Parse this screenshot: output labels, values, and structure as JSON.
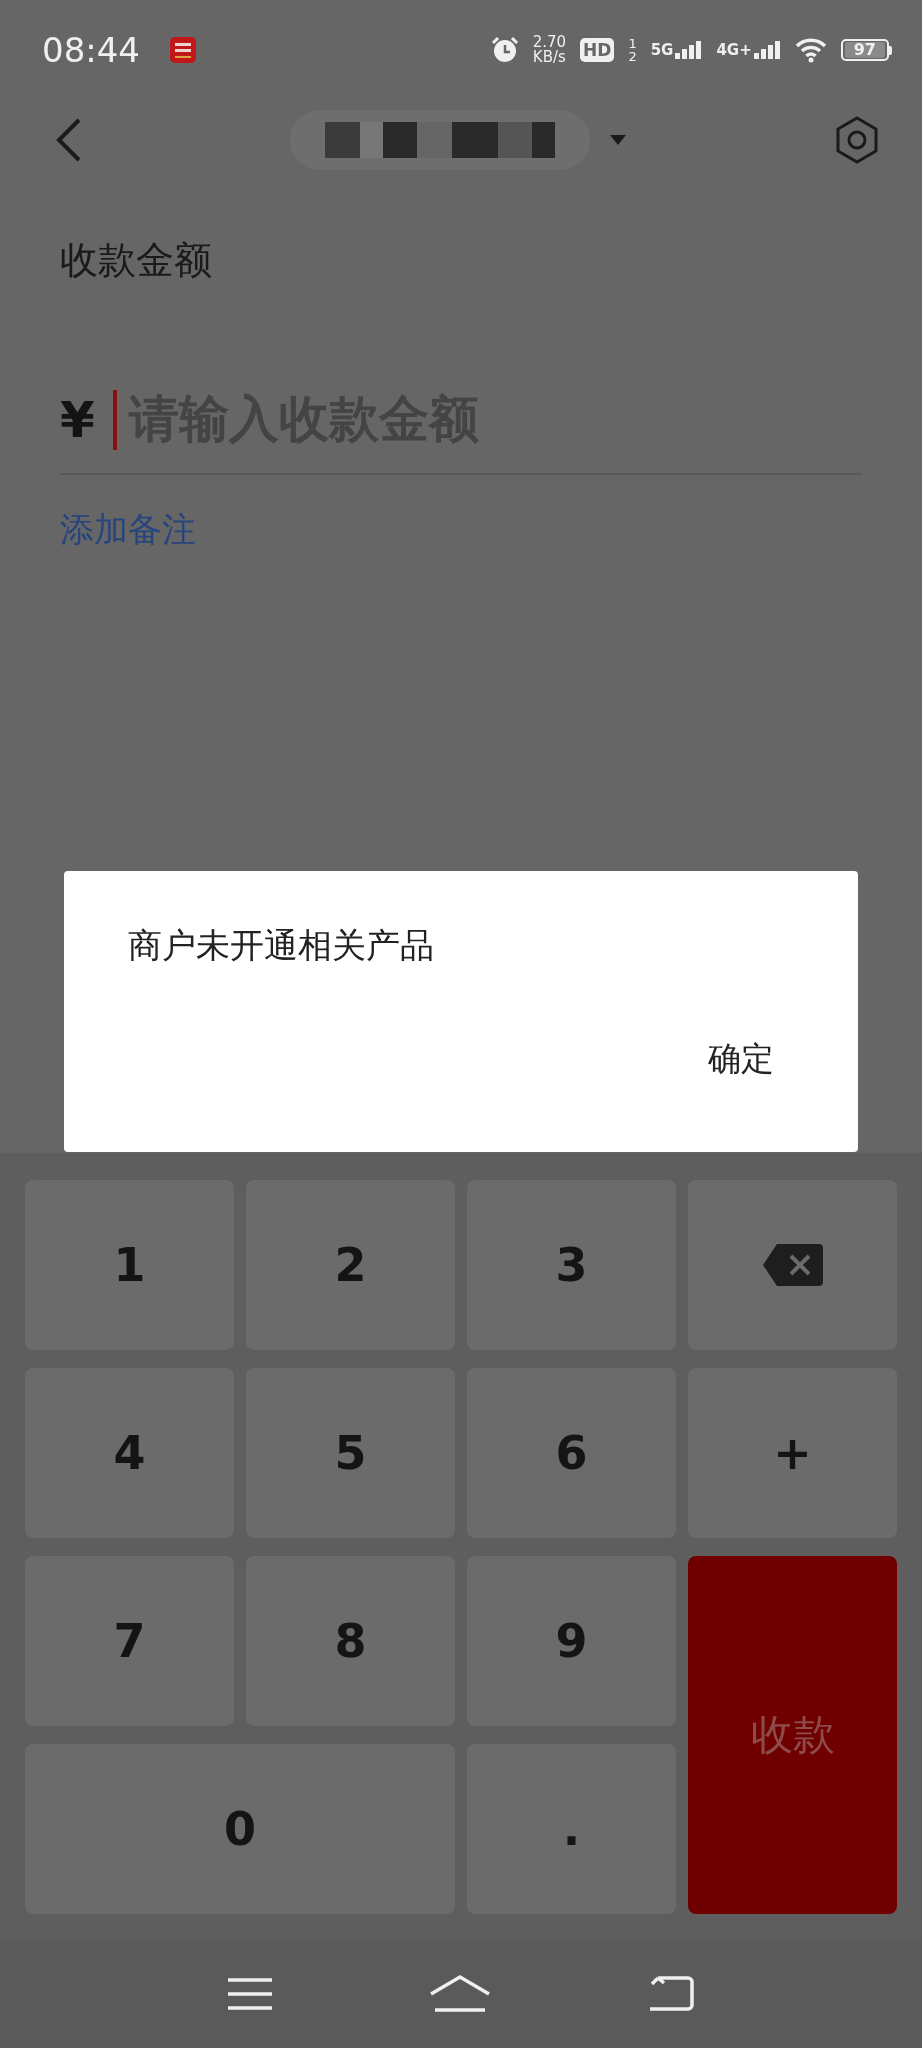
{
  "status_bar": {
    "time": "08:44",
    "net_speed": "2.70",
    "net_speed_unit": "KB/s",
    "hd_label": "HD",
    "sim_1": "1",
    "sim_2": "2",
    "network_1": "5G",
    "network_2": "4G+",
    "battery": "97"
  },
  "form": {
    "label": "收款金额",
    "currency": "¥",
    "amount_placeholder": "请输入收款金额",
    "add_note_link": "添加备注"
  },
  "dialog": {
    "message": "商户未开通相关产品",
    "confirm": "确定"
  },
  "keypad": {
    "keys": [
      {
        "kind": "digit",
        "label": "1"
      },
      {
        "kind": "digit",
        "label": "2"
      },
      {
        "kind": "digit",
        "label": "3"
      },
      {
        "kind": "backspace"
      },
      {
        "kind": "digit",
        "label": "4"
      },
      {
        "kind": "digit",
        "label": "5"
      },
      {
        "kind": "digit",
        "label": "6"
      },
      {
        "kind": "digit",
        "label": "+"
      },
      {
        "kind": "digit",
        "label": "7"
      },
      {
        "kind": "digit",
        "label": "8"
      },
      {
        "kind": "digit",
        "label": "9"
      },
      {
        "kind": "submit",
        "label": "收款"
      },
      {
        "kind": "digit",
        "label": "0",
        "wide": true
      },
      {
        "kind": "digit",
        "label": "."
      }
    ]
  }
}
